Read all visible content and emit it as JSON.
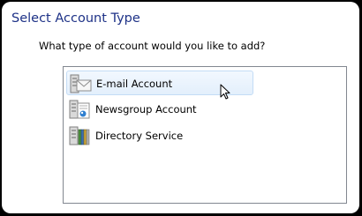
{
  "dialog": {
    "title": "Select Account Type",
    "question": "What type of account would you like to add?"
  },
  "account_types": [
    {
      "label": "E-mail Account",
      "icon": "email-account-icon",
      "selected": true
    },
    {
      "label": "Newsgroup Account",
      "icon": "newsgroup-account-icon",
      "selected": false
    },
    {
      "label": "Directory Service",
      "icon": "directory-service-icon",
      "selected": false
    }
  ],
  "colors": {
    "title": "#1e3287",
    "selection_top": "#f2f8fe",
    "selection_bottom": "#e3effc",
    "selection_border": "#c3dcf5",
    "listbox_border": "#828790"
  }
}
